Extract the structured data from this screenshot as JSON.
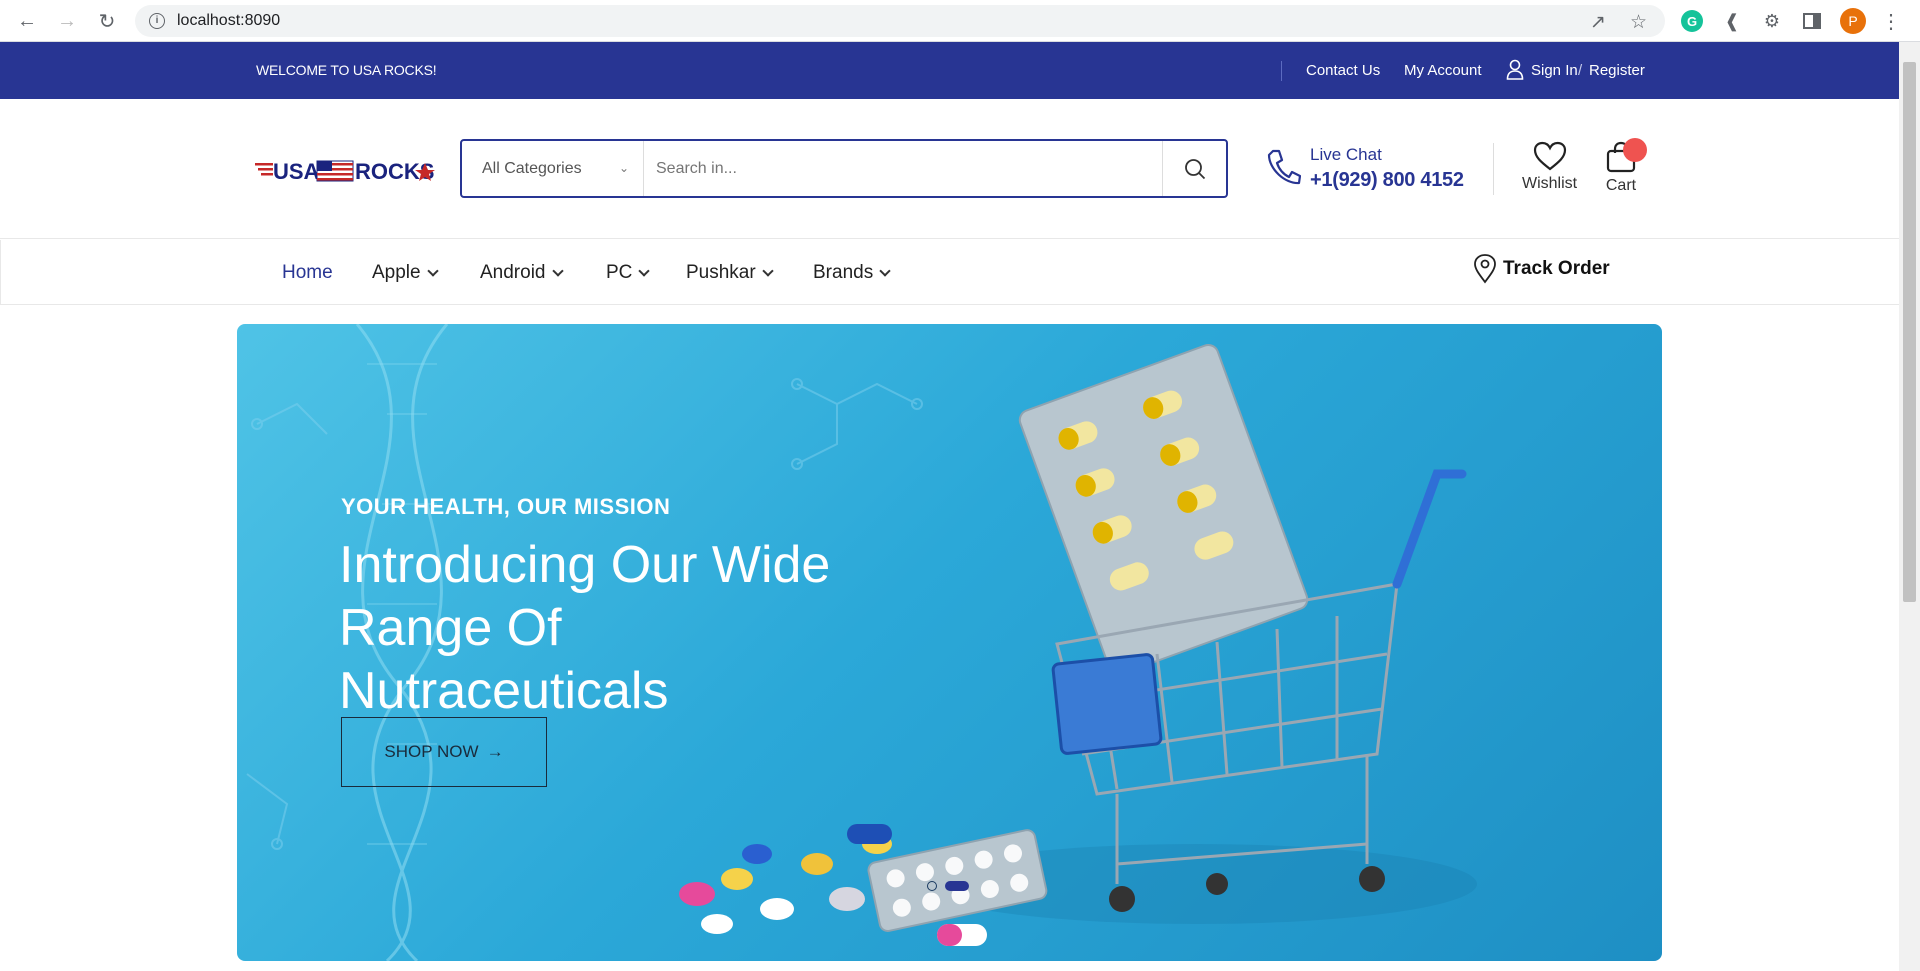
{
  "browser": {
    "url": "localhost:8090",
    "profile_initial": "P"
  },
  "topbar": {
    "welcome": "WELCOME TO USA ROCKS!",
    "contact": "Contact Us",
    "account": "My Account",
    "signin": "Sign In",
    "slash": "/",
    "register": "Register"
  },
  "header": {
    "logo_text_left": "USA",
    "logo_text_right": "ROCKS",
    "category_select": "All Categories",
    "search_placeholder": "Search in...",
    "live_chat_label": "Live Chat",
    "phone": "+1(929) 800 4152",
    "wishlist": "Wishlist",
    "cart": "Cart"
  },
  "nav": {
    "items": [
      {
        "label": "Home"
      },
      {
        "label": "Apple"
      },
      {
        "label": "Android"
      },
      {
        "label": "PC"
      },
      {
        "label": "Pushkar"
      },
      {
        "label": "Brands"
      }
    ],
    "track_order": "Track Order"
  },
  "hero": {
    "subtitle": "YOUR HEALTH, OUR MISSION",
    "title": "Introducing Our Wide Range Of Nutraceuticals",
    "cta": "SHOP NOW",
    "slides": 2,
    "active_slide": 2
  },
  "colors": {
    "brand": "#283593",
    "badge": "#ef5350",
    "hero_bg": "#2ba8d8"
  }
}
